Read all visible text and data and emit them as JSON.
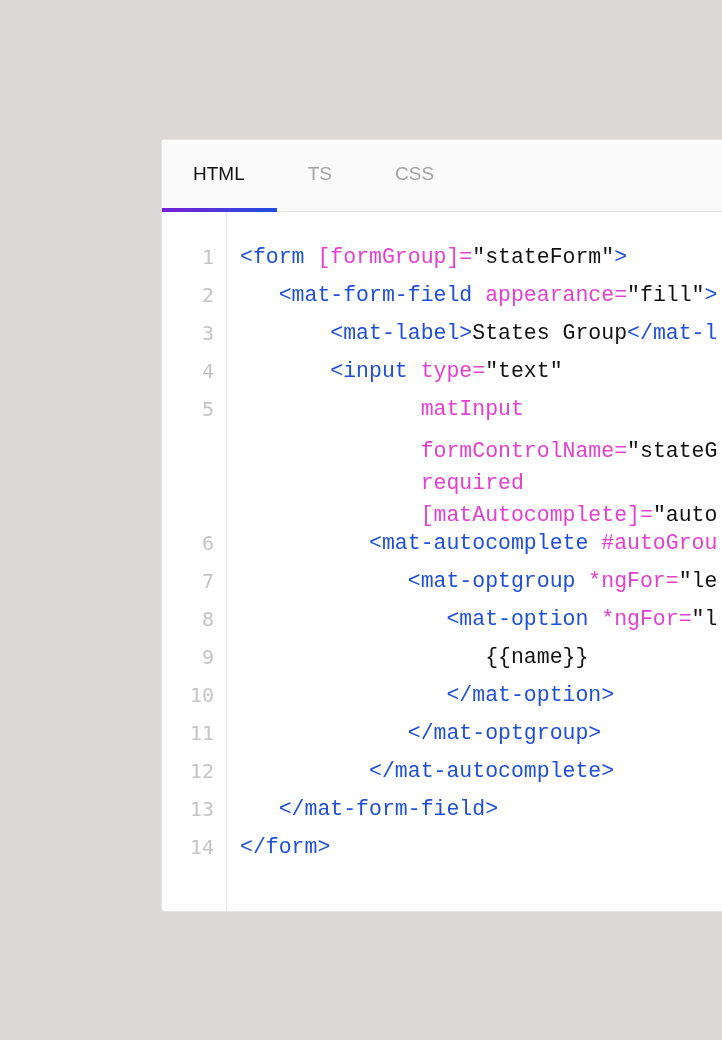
{
  "tabs": [
    {
      "label": "HTML",
      "selected": true
    },
    {
      "label": "TS",
      "selected": false
    },
    {
      "label": "CSS",
      "selected": false
    }
  ],
  "lines": [
    {
      "number": "1",
      "rows": [
        [
          {
            "kind": "tag",
            "text": "<form "
          },
          {
            "kind": "attr",
            "text": "[formGroup]="
          },
          {
            "kind": "value",
            "text": "\"stateForm\""
          },
          {
            "kind": "tag",
            "text": ">"
          }
        ]
      ]
    },
    {
      "number": "2",
      "rows": [
        [
          {
            "kind": "tag",
            "text": "   <mat-form-field "
          },
          {
            "kind": "attr",
            "text": "appearance="
          },
          {
            "kind": "value",
            "text": "\"fill\""
          },
          {
            "kind": "tag",
            "text": ">"
          }
        ]
      ]
    },
    {
      "number": "3",
      "rows": [
        [
          {
            "kind": "tag",
            "text": "       <mat-label>"
          },
          {
            "kind": "value",
            "text": "States Group"
          },
          {
            "kind": "tag",
            "text": "</mat-l"
          }
        ]
      ]
    },
    {
      "number": "4",
      "rows": [
        [
          {
            "kind": "tag",
            "text": "       <input "
          },
          {
            "kind": "attr",
            "text": "type="
          },
          {
            "kind": "value",
            "text": "\"text\""
          }
        ]
      ]
    },
    {
      "number": "5",
      "rows": [
        [
          {
            "kind": "attr",
            "text": "              matInput"
          }
        ],
        [
          {
            "kind": "attr",
            "text": "              formControlName="
          },
          {
            "kind": "value",
            "text": "\"stateG"
          }
        ],
        [
          {
            "kind": "attr",
            "text": "              required"
          }
        ],
        [
          {
            "kind": "attr",
            "text": "              [matAutocomplete]="
          },
          {
            "kind": "value",
            "text": "\"auto"
          }
        ]
      ]
    },
    {
      "number": "6",
      "rows": [
        [
          {
            "kind": "tag",
            "text": "          <mat-autocomplete "
          },
          {
            "kind": "attr",
            "text": "#autoGrou"
          }
        ]
      ]
    },
    {
      "number": "7",
      "rows": [
        [
          {
            "kind": "tag",
            "text": "             <mat-optgroup "
          },
          {
            "kind": "attr",
            "text": "*ngFor="
          },
          {
            "kind": "value",
            "text": "\"le"
          }
        ]
      ]
    },
    {
      "number": "8",
      "rows": [
        [
          {
            "kind": "tag",
            "text": "                <mat-option "
          },
          {
            "kind": "attr",
            "text": "*ngFor="
          },
          {
            "kind": "value",
            "text": "\"l"
          }
        ]
      ]
    },
    {
      "number": "9",
      "rows": [
        [
          {
            "kind": "value",
            "text": "                   {{name}}"
          }
        ]
      ]
    },
    {
      "number": "10",
      "rows": [
        [
          {
            "kind": "tag",
            "text": "                </mat-option>"
          }
        ]
      ]
    },
    {
      "number": "11",
      "rows": [
        [
          {
            "kind": "tag",
            "text": "             </mat-optgroup>"
          }
        ]
      ]
    },
    {
      "number": "12",
      "rows": [
        [
          {
            "kind": "tag",
            "text": "          </mat-autocomplete>"
          }
        ]
      ]
    },
    {
      "number": "13",
      "rows": [
        [
          {
            "kind": "tag",
            "text": "   </mat-form-field>"
          }
        ]
      ]
    },
    {
      "number": "14",
      "rows": [
        [
          {
            "kind": "tag",
            "text": "</form>"
          }
        ]
      ]
    }
  ]
}
